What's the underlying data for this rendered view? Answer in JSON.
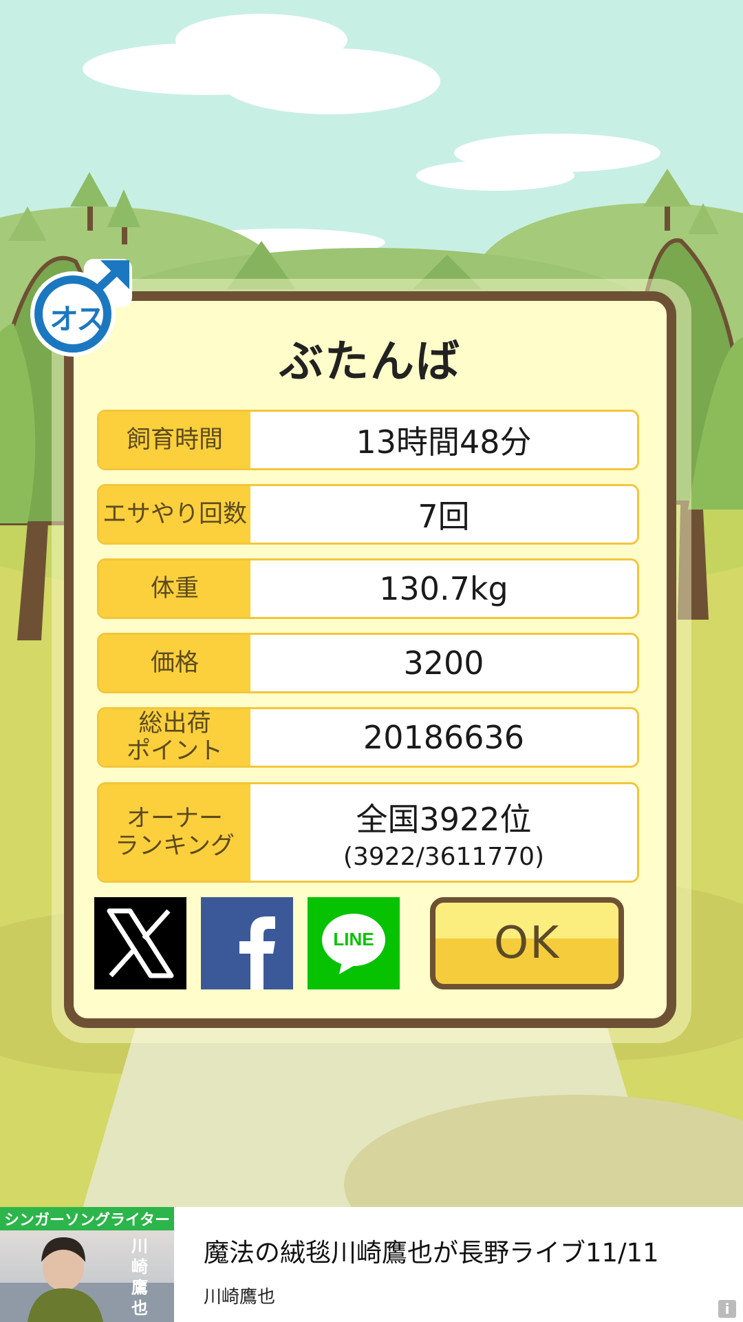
{
  "pig": {
    "name": "ぶたんば",
    "gender_label": "オス"
  },
  "stats": [
    {
      "label": "飼育時間",
      "value": "13時間48分"
    },
    {
      "label": "エサやり回数",
      "value": "7回"
    },
    {
      "label": "体重",
      "value": "130.7kg"
    },
    {
      "label": "価格",
      "value": "3200"
    },
    {
      "label_line1": "総出荷",
      "label_line2": "ポイント",
      "value": "20186636"
    },
    {
      "label_line1": "オーナー",
      "label_line2": "ランキング",
      "value": "全国3922位",
      "value_sub": "(3922/3611770)"
    }
  ],
  "buttons": {
    "ok_label": "OK",
    "share_x": "x-icon",
    "share_facebook": "facebook-icon",
    "share_line_label": "LINE"
  },
  "ad": {
    "tag": "シンガーソングライター",
    "vertical_name": "川崎鷹也",
    "title": "魔法の絨毯川崎鷹也が長野ライブ11/11",
    "subtitle": "川崎鷹也",
    "info_icon": "i"
  },
  "colors": {
    "frame": "#6e5134",
    "label_bg": "#fbd03c",
    "panel_bg": "#fffdc9",
    "male_blue": "#1b78c0"
  }
}
